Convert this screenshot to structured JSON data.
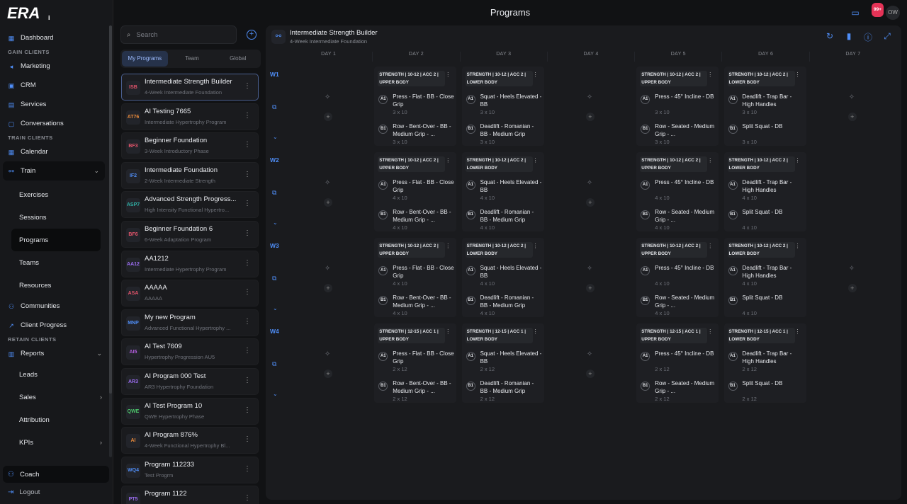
{
  "header": {
    "title": "Programs",
    "notification_badge": "99+",
    "avatar": "OW"
  },
  "sidebar": {
    "dashboard": "Dashboard",
    "gain_clients": "GAIN CLIENTS",
    "marketing": "Marketing",
    "crm": "CRM",
    "services": "Services",
    "conversations": "Conversations",
    "train_clients": "TRAIN CLIENTS",
    "calendar": "Calendar",
    "train": "Train",
    "exercises": "Exercises",
    "sessions": "Sessions",
    "programs": "Programs",
    "teams": "Teams",
    "resources": "Resources",
    "communities": "Communities",
    "client_progress": "Client Progress",
    "retain_clients": "RETAIN CLIENTS",
    "reports": "Reports",
    "leads": "Leads",
    "sales": "Sales",
    "attribution": "Attribution",
    "kpis": "KPIs",
    "coach": "Coach",
    "logout": "Logout"
  },
  "programs_panel": {
    "search_placeholder": "Search",
    "tabs": [
      "My Programs",
      "Team",
      "Global"
    ],
    "programs": [
      {
        "abbr": "ISB",
        "name": "Intermediate Strength Builder",
        "desc": "4-Week Intermediate Foundation",
        "color": "#e0536a"
      },
      {
        "abbr": "AT76",
        "name": "AI Testing 7665",
        "desc": "Intermediate Hypertrophy Program",
        "color": "#e8893a"
      },
      {
        "abbr": "BF3",
        "name": "Beginner Foundation",
        "desc": "3-Week Introductory Phase",
        "color": "#e0536a"
      },
      {
        "abbr": "IF2",
        "name": "Intermediate Foundation",
        "desc": "2-Week Intermediate Strength",
        "color": "#4f8ef7"
      },
      {
        "abbr": "ASP7",
        "name": "Advanced Strength Progress...",
        "desc": "High Intensity Functional Hypertro...",
        "color": "#2fb3a8"
      },
      {
        "abbr": "BF6",
        "name": "Beginner Foundation 6",
        "desc": "6-Week Adaptation Program",
        "color": "#e0536a"
      },
      {
        "abbr": "AA12",
        "name": "AA1212",
        "desc": "Intermediate Hypertrophy Program",
        "color": "#9b6cf0"
      },
      {
        "abbr": "ASA",
        "name": "AAAAA",
        "desc": "AAAAA",
        "color": "#e0536a"
      },
      {
        "abbr": "MNP",
        "name": "My new Program",
        "desc": "Advanced Functional Hypertrophy ...",
        "color": "#4f8ef7"
      },
      {
        "abbr": "AI5",
        "name": "AI Test 7609",
        "desc": "Hypertrophy Progression AU5",
        "color": "#b45ee0"
      },
      {
        "abbr": "AR3",
        "name": "AI Program 000 Test",
        "desc": "AR3 Hypertrophy Foundation",
        "color": "#9b6cf0"
      },
      {
        "abbr": "QWE",
        "name": "AI Test Program 10",
        "desc": "QWE Hypertrophy Phase",
        "color": "#4cc46a"
      },
      {
        "abbr": "AI",
        "name": "AI Program 876%",
        "desc": "4-Week Functional Hypertrophy Bl...",
        "color": "#e8893a"
      },
      {
        "abbr": "WQ4",
        "name": "Program 112233",
        "desc": "Test Progrm",
        "color": "#4f8ef7"
      },
      {
        "abbr": "PT5",
        "name": "Program 1122",
        "desc": "",
        "color": "#9b6cf0"
      }
    ]
  },
  "program": {
    "title": "Intermediate Strength Builder",
    "subtitle": "4-Week Intermediate Foundation"
  },
  "days": [
    "DAY 1",
    "DAY 2",
    "DAY 3",
    "DAY 4",
    "DAY 5",
    "DAY 6",
    "DAY 7"
  ],
  "weeks": [
    {
      "label": "W1",
      "sessions": [
        {
          "day": 1,
          "title": "STRENGTH | 10-12 | ACC 2 |",
          "name": "UPPER BODY",
          "ex": [
            [
              "A1",
              "Press - Flat - BB - Close Grip",
              "3 x 10"
            ],
            [
              "B1",
              "Row - Bent-Over - BB - Medium Grip - ...",
              "3 x 10"
            ]
          ]
        },
        {
          "day": 2,
          "title": "STRENGTH | 10-12 | ACC 2 |",
          "name": "LOWER BODY",
          "ex": [
            [
              "A1",
              "Squat - Heels Elevated - BB",
              "3 x 10"
            ],
            [
              "B1",
              "Deadlift - Romanian - BB - Medium Grip",
              "3 x 10"
            ]
          ]
        },
        {
          "day": 4,
          "title": "STRENGTH | 10-12 | ACC 2 |",
          "name": "UPPER BODY",
          "ex": [
            [
              "A1",
              "Press - 45° Incline - DB",
              "3 x 10"
            ],
            [
              "B1",
              "Row - Seated - Medium Grip - ...",
              "3 x 10"
            ]
          ]
        },
        {
          "day": 5,
          "title": "STRENGTH | 10-12 | ACC 2 |",
          "name": "LOWER BODY",
          "ex": [
            [
              "A1",
              "Deadlift - Trap Bar - High Handles",
              "3 x 10"
            ],
            [
              "B1",
              "Split Squat - DB",
              "3 x 10"
            ]
          ]
        }
      ]
    },
    {
      "label": "W2",
      "sessions": [
        {
          "day": 1,
          "title": "STRENGTH | 10-12 | ACC 2 |",
          "name": "UPPER BODY",
          "ex": [
            [
              "A1",
              "Press - Flat - BB - Close Grip",
              "4 x 10"
            ],
            [
              "B1",
              "Row - Bent-Over - BB - Medium Grip - ...",
              "4 x 10"
            ]
          ]
        },
        {
          "day": 2,
          "title": "STRENGTH | 10-12 | ACC 2 |",
          "name": "LOWER BODY",
          "ex": [
            [
              "A1",
              "Squat - Heels Elevated - BB",
              "4 x 10"
            ],
            [
              "B1",
              "Deadlift - Romanian - BB - Medium Grip",
              "4 x 10"
            ]
          ]
        },
        {
          "day": 4,
          "title": "STRENGTH | 10-12 | ACC 2 |",
          "name": "UPPER BODY",
          "ex": [
            [
              "A1",
              "Press - 45° Incline - DB",
              "4 x 10"
            ],
            [
              "B1",
              "Row - Seated - Medium Grip - ...",
              "4 x 10"
            ]
          ]
        },
        {
          "day": 5,
          "title": "STRENGTH | 10-12 | ACC 2 |",
          "name": "LOWER BODY",
          "ex": [
            [
              "A1",
              "Deadlift - Trap Bar - High Handles",
              "4 x 10"
            ],
            [
              "B1",
              "Split Squat - DB",
              "4 x 10"
            ]
          ]
        }
      ]
    },
    {
      "label": "W3",
      "sessions": [
        {
          "day": 1,
          "title": "STRENGTH | 10-12 | ACC 2 |",
          "name": "UPPER BODY",
          "ex": [
            [
              "A1",
              "Press - Flat - BB - Close Grip",
              "4 x 10"
            ],
            [
              "B1",
              "Row - Bent-Over - BB - Medium Grip - ...",
              "4 x 10"
            ]
          ]
        },
        {
          "day": 2,
          "title": "STRENGTH | 10-12 | ACC 2 |",
          "name": "LOWER BODY",
          "ex": [
            [
              "A1",
              "Squat - Heels Elevated - BB",
              "4 x 10"
            ],
            [
              "B1",
              "Deadlift - Romanian - BB - Medium Grip",
              "4 x 10"
            ]
          ]
        },
        {
          "day": 4,
          "title": "STRENGTH | 10-12 | ACC 2 |",
          "name": "UPPER BODY",
          "ex": [
            [
              "A1",
              "Press - 45° Incline - DB",
              "4 x 10"
            ],
            [
              "B1",
              "Row - Seated - Medium Grip - ...",
              "4 x 10"
            ]
          ]
        },
        {
          "day": 5,
          "title": "STRENGTH | 10-12 | ACC 2 |",
          "name": "LOWER BODY",
          "ex": [
            [
              "A1",
              "Deadlift - Trap Bar - High Handles",
              "4 x 10"
            ],
            [
              "B1",
              "Split Squat - DB",
              "4 x 10"
            ]
          ]
        }
      ]
    },
    {
      "label": "W4",
      "sessions": [
        {
          "day": 1,
          "title": "STRENGTH | 12-15 | ACC 1 |",
          "name": "UPPER BODY",
          "ex": [
            [
              "A1",
              "Press - Flat - BB - Close Grip",
              "2 x 12"
            ],
            [
              "B1",
              "Row - Bent-Over - BB - Medium Grip - ...",
              "2 x 12"
            ]
          ]
        },
        {
          "day": 2,
          "title": "STRENGTH | 12-15 | ACC 1 |",
          "name": "LOWER BODY",
          "ex": [
            [
              "A1",
              "Squat - Heels Elevated - BB",
              "2 x 12"
            ],
            [
              "B1",
              "Deadlift - Romanian - BB - Medium Grip",
              "2 x 12"
            ]
          ]
        },
        {
          "day": 4,
          "title": "STRENGTH | 12-15 | ACC 1 |",
          "name": "UPPER BODY",
          "ex": [
            [
              "A1",
              "Press - 45° Incline - DB",
              "2 x 12"
            ],
            [
              "B1",
              "Row - Seated - Medium Grip - ...",
              "2 x 12"
            ]
          ]
        },
        {
          "day": 5,
          "title": "STRENGTH | 12-15 | ACC 1 |",
          "name": "LOWER BODY",
          "ex": [
            [
              "A1",
              "Deadlift - Trap Bar - High Handles",
              "2 x 12"
            ],
            [
              "B1",
              "Split Squat - DB",
              "2 x 12"
            ]
          ]
        }
      ]
    }
  ],
  "empty_days": {
    "W1": [
      0,
      3,
      6
    ],
    "W2": [
      0,
      3
    ],
    "W3": [
      0,
      3,
      6
    ],
    "W4": [
      0,
      3
    ]
  }
}
